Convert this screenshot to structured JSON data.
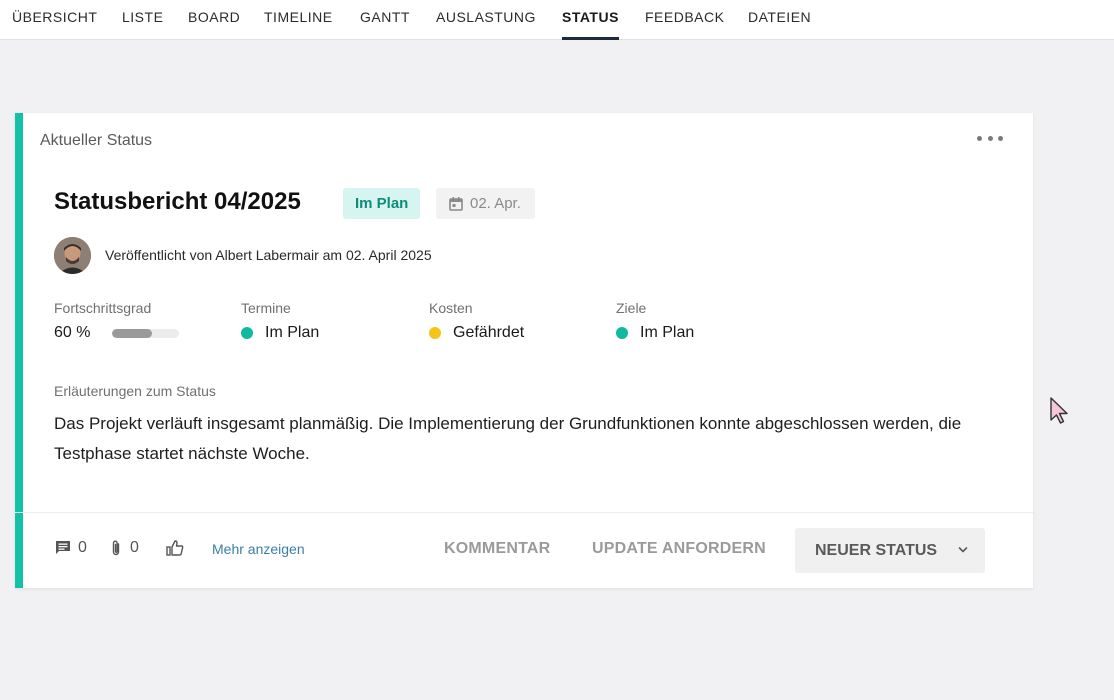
{
  "nav": {
    "tabs": [
      {
        "label": "ÜBERSICHT"
      },
      {
        "label": "LISTE"
      },
      {
        "label": "BOARD"
      },
      {
        "label": "TIMELINE"
      },
      {
        "label": "GANTT"
      },
      {
        "label": "AUSLASTUNG"
      },
      {
        "label": "STATUS"
      },
      {
        "label": "FEEDBACK"
      },
      {
        "label": "DATEIEN"
      }
    ],
    "active": "STATUS"
  },
  "card": {
    "header": "Aktueller Status",
    "title": "Statusbericht 04/2025",
    "status_badge": "Im Plan",
    "date_badge": "02. Apr.",
    "published": "Veröffentlicht von Albert Labermair am 02. April 2025",
    "metrics": {
      "progress": {
        "label": "Fortschrittsgrad",
        "value": "60 %",
        "fraction": 0.6
      },
      "termine": {
        "label": "Termine",
        "value": "Im Plan",
        "color": "#11b9a0"
      },
      "kosten": {
        "label": "Kosten",
        "value": "Gefährdet",
        "color": "#f5c518"
      },
      "ziele": {
        "label": "Ziele",
        "value": "Im Plan",
        "color": "#11b9a0"
      }
    },
    "explanation_label": "Erläuterungen zum Status",
    "explanation_text": "Das Projekt verläuft insgesamt planmäßig. Die Implementierung der Grundfunktionen konnte abgeschlossen werden, die Testphase startet nächste Woche.",
    "footer": {
      "comments_count": "0",
      "attachments_count": "0",
      "more_link": "Mehr anzeigen",
      "btn_comment": "KOMMENTAR",
      "btn_request": "UPDATE ANFORDERN",
      "btn_new": "NEUER STATUS"
    }
  },
  "colors": {
    "accent": "#11c2a7",
    "nav_underline": "#1d2b3c"
  }
}
